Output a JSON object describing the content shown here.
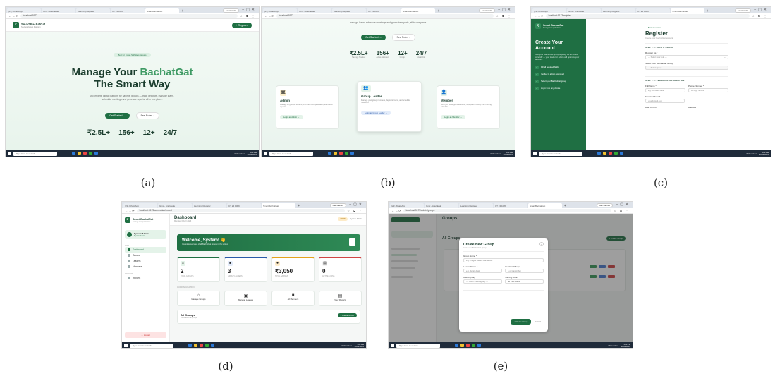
{
  "captions": {
    "a": "(a)",
    "b": "(b)",
    "c": "(c)",
    "d": "(d)",
    "e": "(e)"
  },
  "browser": {
    "tabs": [
      "(21) WhatsApp",
      "Gmx - Anuldeale",
      "Learning Register",
      "CT 24 1089",
      "SmartBachatGat"
    ],
    "gemini": "Ask Gemini",
    "urls": {
      "a": "localhost:5173",
      "b": "localhost:5173",
      "c": "localhost:5173/register",
      "d": "localhost:5173/admin/dashboard",
      "e": "localhost:5173/admin/groups"
    }
  },
  "taskbar": {
    "search": "Type here to search",
    "weather": "27°C Clear",
    "time": "1:06 PM",
    "date": "06-04-2025"
  },
  "brand": {
    "name": "Smart BachatGat",
    "tagline": "Savings Group Platform"
  },
  "landing": {
    "register_btn": "+ Register",
    "badge": "Built for Indian Self-Help Groups",
    "title_line1": "Manage Your",
    "title_accent": "BachatGat",
    "title_line2": "The Smart Way",
    "desc": "A complete digital platform for savings groups — track deposits, manage loans, schedule meetings and generate reports, all in one place.",
    "desc_top": "manage loans, schedule meetings and generate reports, all in one place.",
    "get_started": "Get Started →",
    "see_roles": "See Roles ↓",
    "stats": [
      {
        "value": "₹2.5L+",
        "label": "Savings Tracked"
      },
      {
        "value": "156+",
        "label": "Active Members"
      },
      {
        "value": "12+",
        "label": "Groups"
      },
      {
        "value": "24/7",
        "label": "Available"
      }
    ]
  },
  "roles": [
    {
      "title": "Admin",
      "desc": "Manage all groups, leaders, members and generate system-wide reports.",
      "btn": "Login as Admin →"
    },
    {
      "title": "Group Leader",
      "desc": "Manage your group members, deposits, loans, and schedule meetings.",
      "btn": "Login as Group Leader →"
    },
    {
      "title": "Member",
      "desc": "View your savings, loan status, repayment history and meeting schedule.",
      "btn": "Login as Member →"
    }
  ],
  "register": {
    "side_title": "Create Your Account",
    "side_desc": "Join your BachatGat group digitally. Fill all details carefully — your leader or admin will approve your account.",
    "side_steps": [
      "Fill all required fields",
      "Verified & admin approved",
      "Select your BachatGat group",
      "Login from any device"
    ],
    "back": "← Back to Home",
    "title": "Register",
    "subtitle": "Create your BachatGat account",
    "step1": "STEP 1 — ROLE & GROUP",
    "role_label": "Register As *",
    "role_placeholder": "— Select your role —",
    "group_label": "Select Your BachatGat Group *",
    "group_placeholder": "— Select group —",
    "step2": "STEP 2 — PERSONAL INFORMATION",
    "fullname_label": "Full Name *",
    "fullname_ph": "e.g. Ramesh Patil",
    "phone_label": "Phone Number *",
    "phone_ph": "10-digit number",
    "email_label": "Email Address *",
    "email_ph": "you@gmail.com",
    "dob_label": "Date of Birth",
    "address_label": "Address"
  },
  "dashboard": {
    "title": "Dashboard",
    "subtitle": "Monday, 6 April 2026",
    "role_badge": "ADMIN",
    "user_top": "System Admin",
    "user_name": "System Admin",
    "user_role": "System Admin",
    "nav_main": "MAIN",
    "nav": [
      "Dashboard",
      "Groups",
      "Leaders",
      "Members"
    ],
    "nav_reports_head": "REPORTS",
    "nav_reports": "Reports",
    "logout": "→ Logout",
    "welcome": "Welcome, System! 👋",
    "welcome_sub": "Complete overview of all BachatGat groups in the system",
    "kpis": [
      {
        "value": "2",
        "label": "TOTAL GROUPS"
      },
      {
        "value": "3",
        "label": "GROUP LEADERS"
      },
      {
        "value": "₹3,050",
        "label": "TOTAL SAVINGS"
      },
      {
        "value": "0",
        "label": "ACTIVE LOANS"
      }
    ],
    "quick_head": "QUICK NAVIGATION",
    "quick": [
      "Manage Groups",
      "Manage Leaders",
      "All Members",
      "View Reports"
    ],
    "all_groups": "All Groups",
    "all_groups_sub": "Overview of all groups",
    "create_btn": "+ Create Group"
  },
  "groups": {
    "title": "Groups",
    "page_head": "All Groups",
    "create_btn": "+ Create Group"
  },
  "modal": {
    "title": "Create New Group",
    "sub": "Add a new BachatGat group",
    "name_label": "Group Name *",
    "name_ph": "e.g. Pragati Mahila BachatGat",
    "leader_label": "Leader Name *",
    "leader_ph": "e.g. Sunita Patil",
    "village_label": "Location/Village",
    "village_ph": "e.g. Gangir Sai",
    "meeting_label": "Meeting Day",
    "meeting_ph": "— Select meeting day —",
    "start_label": "Starting Date",
    "start_val": "06 - 04 - 2026",
    "create": "+ Create Group",
    "cancel": "Cancel"
  }
}
